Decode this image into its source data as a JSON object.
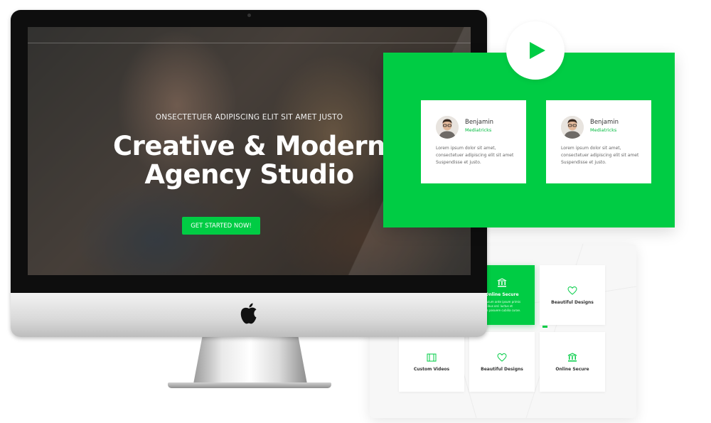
{
  "hero": {
    "kicker": "ONSECTETUER ADIPISCING ELIT SIT AMET JUSTO",
    "title_line1": "Creative & Modern",
    "title_line2": "Agency Studio",
    "cta_label": "GET STARTED NOW!"
  },
  "testimonials": [
    {
      "name": "Benjamin",
      "company": "Mediatricks",
      "quote_line1": "Lorem ipsum dolor sit amet,",
      "quote_line2": "consectetuer adipiscing elit sit amet",
      "quote_line3": "Suspendisse et justo."
    },
    {
      "name": "Benjamin",
      "company": "Mediatricks",
      "quote_line1": "Lorem ipsum dolor sit amet,",
      "quote_line2": "consectetuer adipiscing elit sit amet",
      "quote_line3": "Suspendisse et justo."
    }
  ],
  "features": {
    "active": {
      "label": "Online Secure",
      "desc_line1": "Bactibulum ante ipsum primis",
      "desc_line2": "in faucibus orci luctus et",
      "desc_line3": "ultrices posuere cubilia curae."
    },
    "tiles": [
      {
        "label": "Beautiful Designs",
        "icon": "heart-icon"
      },
      {
        "label": "Custom Videos",
        "icon": "video-icon"
      },
      {
        "label": "Beautiful Designs",
        "icon": "heart-icon"
      },
      {
        "label": "Online Secure",
        "icon": "bank-icon"
      }
    ]
  },
  "colors": {
    "accent": "#00cc44",
    "card_bg": "#ffffff",
    "panel_bg": "#f7f7f7"
  }
}
